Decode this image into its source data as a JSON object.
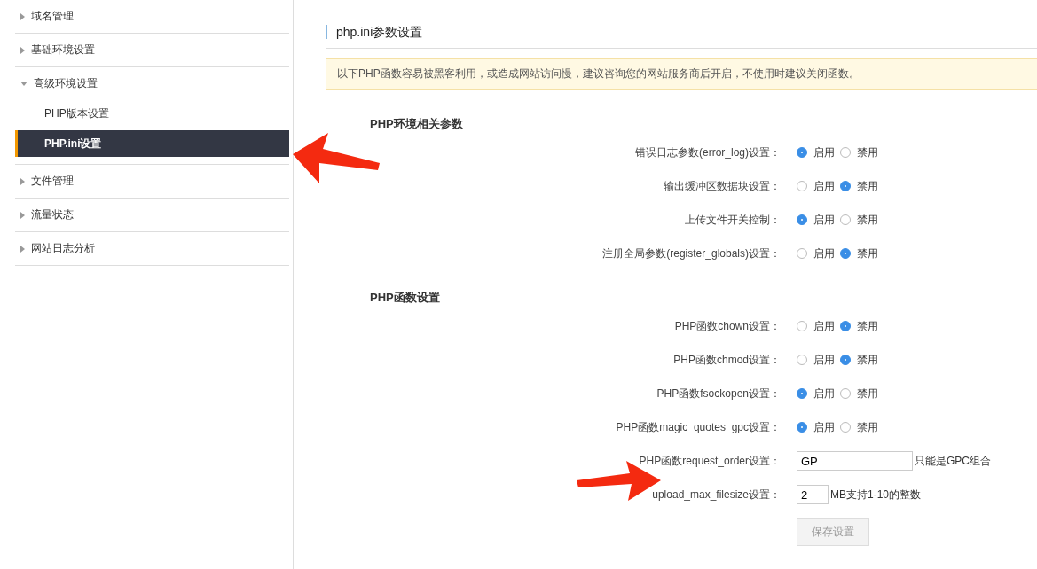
{
  "sidebar": {
    "items": [
      {
        "label": "域名管理",
        "expanded": false
      },
      {
        "label": "基础环境设置",
        "expanded": false
      },
      {
        "label": "高级环境设置",
        "expanded": true,
        "children": [
          {
            "label": "PHP版本设置",
            "selected": false
          },
          {
            "label": "PHP.ini设置",
            "selected": true
          }
        ]
      },
      {
        "label": "文件管理",
        "expanded": false
      },
      {
        "label": "流量状态",
        "expanded": false
      },
      {
        "label": "网站日志分析",
        "expanded": false
      }
    ]
  },
  "page_title": "php.ini参数设置",
  "notice": "以下PHP函数容易被黑客利用，或造成网站访问慢，建议咨询您的网站服务商后开启，不使用时建议关闭函数。",
  "sections": [
    {
      "title": "PHP环境相关参数",
      "rows": [
        {
          "kind": "radio",
          "label": "错误日志参数(error_log)设置：",
          "options": [
            {
              "label": "启用",
              "selected": true
            },
            {
              "label": "禁用",
              "selected": false
            }
          ]
        },
        {
          "kind": "radio",
          "label": "输出缓冲区数据块设置：",
          "options": [
            {
              "label": "启用",
              "selected": false
            },
            {
              "label": "禁用",
              "selected": true
            }
          ]
        },
        {
          "kind": "radio",
          "label": "上传文件开关控制：",
          "options": [
            {
              "label": "启用",
              "selected": true
            },
            {
              "label": "禁用",
              "selected": false
            }
          ]
        },
        {
          "kind": "radio",
          "label": "注册全局参数(register_globals)设置：",
          "options": [
            {
              "label": "启用",
              "selected": false
            },
            {
              "label": "禁用",
              "selected": true
            }
          ]
        }
      ]
    },
    {
      "title": "PHP函数设置",
      "rows": [
        {
          "kind": "radio",
          "label": "PHP函数chown设置：",
          "options": [
            {
              "label": "启用",
              "selected": false
            },
            {
              "label": "禁用",
              "selected": true
            }
          ]
        },
        {
          "kind": "radio",
          "label": "PHP函数chmod设置：",
          "options": [
            {
              "label": "启用",
              "selected": false
            },
            {
              "label": "禁用",
              "selected": true
            }
          ]
        },
        {
          "kind": "radio",
          "label": "PHP函数fsockopen设置：",
          "options": [
            {
              "label": "启用",
              "selected": true
            },
            {
              "label": "禁用",
              "selected": false
            }
          ]
        },
        {
          "kind": "radio",
          "label": "PHP函数magic_quotes_gpc设置：",
          "options": [
            {
              "label": "启用",
              "selected": true
            },
            {
              "label": "禁用",
              "selected": false
            }
          ]
        },
        {
          "kind": "text",
          "label": "PHP函数request_order设置：",
          "value": "GP",
          "hint": "只能是GPC组合"
        },
        {
          "kind": "number",
          "label": "upload_max_filesize设置：",
          "value": "2",
          "hint": "MB支持1-10的整数"
        }
      ]
    }
  ],
  "save_button": {
    "label": "保存设置",
    "disabled": true
  }
}
